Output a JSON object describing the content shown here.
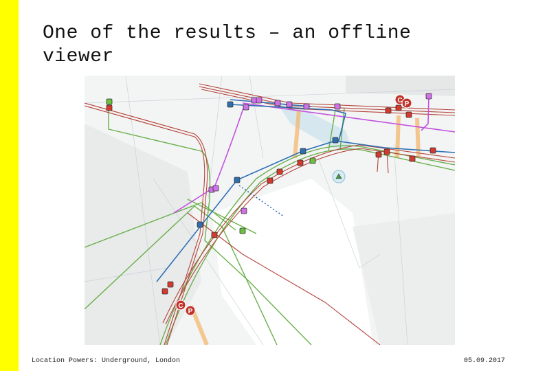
{
  "slide": {
    "title": "One of the results – an offline viewer",
    "footer_left": "Location Powers: Underground, London",
    "footer_right": "05.09.2017",
    "accent_bar_color": "#ffff00"
  },
  "map": {
    "kind": "utility network offline viewer map",
    "layer_colors": {
      "electric": "#c0392b",
      "telecom": "#6ab04c",
      "water": "#2e6fb5",
      "gas": "#c252e0",
      "heat": "#f0a040"
    },
    "marker_icons": [
      "red-square-node",
      "magenta-square-node",
      "blue-square-node",
      "green-square-node",
      "c-marker-icon",
      "p-marker-icon",
      "green-triangle-icon"
    ]
  }
}
